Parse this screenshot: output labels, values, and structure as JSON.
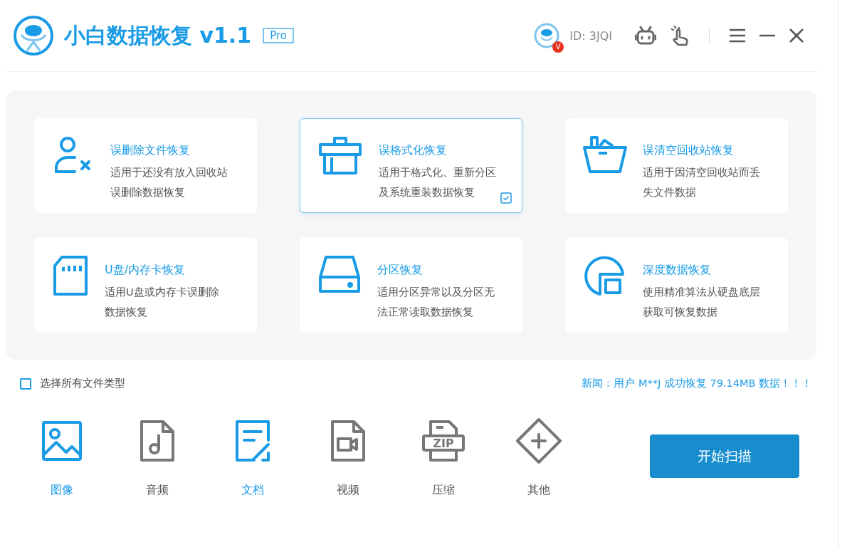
{
  "header": {
    "title": "小白数据恢复 v1.1",
    "edition": "Pro",
    "user_badge": "V",
    "user_id": "ID: 3JQI"
  },
  "modes": [
    {
      "kind": "user-delete",
      "title": "误删除文件恢复",
      "desc": "适用于还没有放入回收站误删除数据恢复",
      "selected": false
    },
    {
      "kind": "format",
      "title": "误格式化恢复",
      "desc": "适用于格式化、重新分区及系统重装数据恢复",
      "selected": true
    },
    {
      "kind": "recycle",
      "title": "误清空回收站恢复",
      "desc": "适用于因清空回收站而丢失文件数据",
      "selected": false
    },
    {
      "kind": "card",
      "title": "U盘/内存卡恢复",
      "desc": "适用U盘或内存卡误删除数据恢复",
      "selected": false
    },
    {
      "kind": "partition",
      "title": "分区恢复",
      "desc": "适用分区异常以及分区无法正常读取数据恢复",
      "selected": false
    },
    {
      "kind": "deep",
      "title": "深度数据恢复",
      "desc": "使用精准算法从硬盘底层获取可恢复数据",
      "selected": false
    }
  ],
  "select_all": {
    "label": "选择所有文件类型",
    "checked": false
  },
  "news": "新闻：用户 M**J 成功恢复 79.14MB 数据！！！",
  "file_types": [
    {
      "kind": "image",
      "label": "图像",
      "selected": true
    },
    {
      "kind": "audio",
      "label": "音频",
      "selected": false
    },
    {
      "kind": "document",
      "label": "文档",
      "selected": true
    },
    {
      "kind": "video",
      "label": "视频",
      "selected": false
    },
    {
      "kind": "zip",
      "label": "压缩",
      "icon_text": "ZIP",
      "selected": false
    },
    {
      "kind": "other",
      "label": "其他",
      "selected": false
    }
  ],
  "scan_button": "开始扫描"
}
